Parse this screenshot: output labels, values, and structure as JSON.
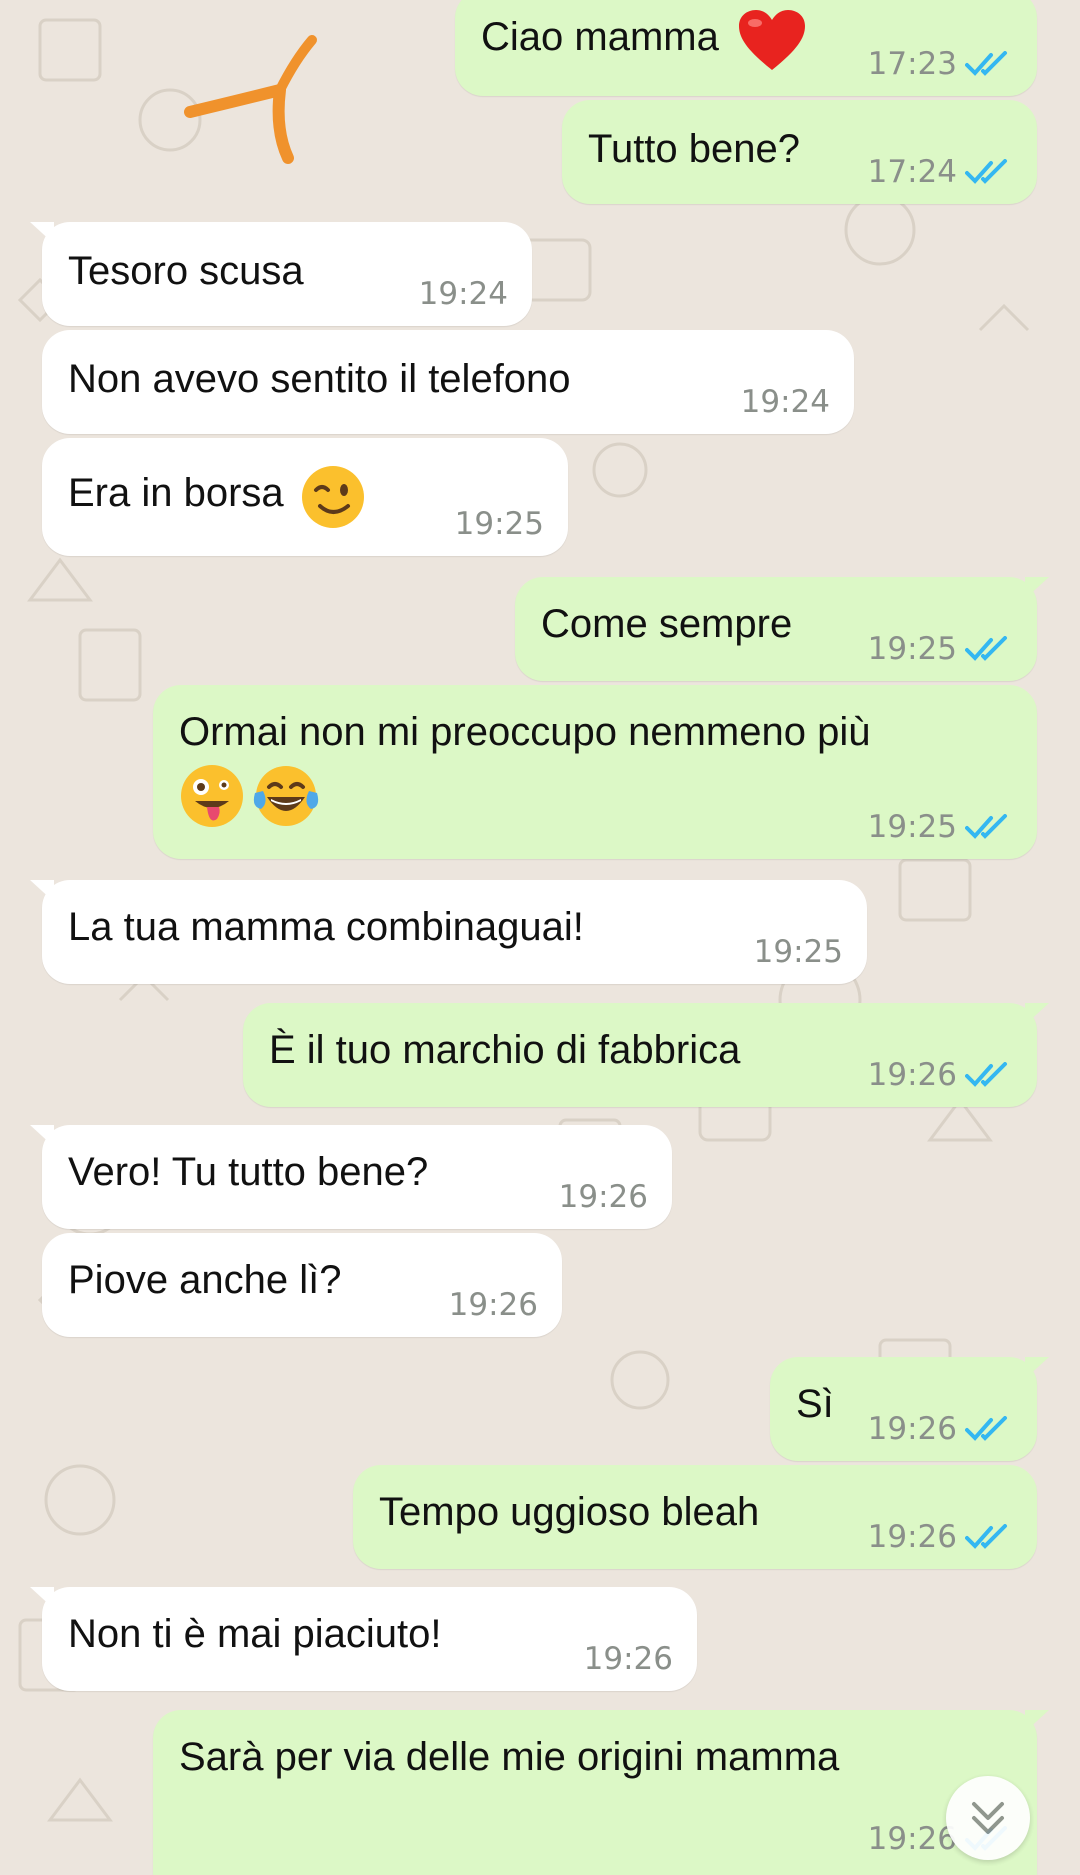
{
  "colors": {
    "background": "#ece5dd",
    "incoming_bubble": "#ffffff",
    "outgoing_bubble": "#dcf8c6",
    "read_ticks": "#34b7f1",
    "timestamp": "#8a8f8a",
    "annotation": "#f0922c"
  },
  "messages": [
    {
      "dir": "out",
      "text": "Ciao mamma",
      "emoji": "heart",
      "time": "17:23",
      "read": true
    },
    {
      "dir": "out",
      "text": "Tutto bene?",
      "time": "17:24",
      "read": true
    },
    {
      "dir": "in",
      "text": "Tesoro scusa",
      "time": "19:24"
    },
    {
      "dir": "in",
      "text": "Non avevo sentito il telefono",
      "time": "19:24"
    },
    {
      "dir": "in",
      "text": "Era in borsa",
      "emoji": "winking-face",
      "time": "19:25"
    },
    {
      "dir": "out",
      "text": "Come sempre",
      "time": "19:25",
      "read": true
    },
    {
      "dir": "out",
      "text": "Ormai non mi preoccupo nemmeno più",
      "emoji": "zany-face, tears-of-joy",
      "time": "19:25",
      "read": true
    },
    {
      "dir": "in",
      "text": "La tua mamma combinaguai!",
      "time": "19:25"
    },
    {
      "dir": "out",
      "text": "È il tuo marchio di fabbrica",
      "time": "19:26",
      "read": true
    },
    {
      "dir": "in",
      "text": "Vero! Tu tutto bene?",
      "time": "19:26"
    },
    {
      "dir": "in",
      "text": "Piove anche lì?",
      "time": "19:26"
    },
    {
      "dir": "out",
      "text": "Sì",
      "time": "19:26",
      "read": true
    },
    {
      "dir": "out",
      "text": "Tempo uggioso bleah",
      "time": "19:26",
      "read": true
    },
    {
      "dir": "in",
      "text": "Non ti è mai piaciuto!",
      "time": "19:26"
    },
    {
      "dir": "out",
      "text": "Sarà per via delle mie origini mamma",
      "time": "19:26",
      "read": true
    }
  ],
  "scroll_button_icon": "double-chevron-down-icon",
  "annotation_icon": "hand-drawn-arrow-icon"
}
